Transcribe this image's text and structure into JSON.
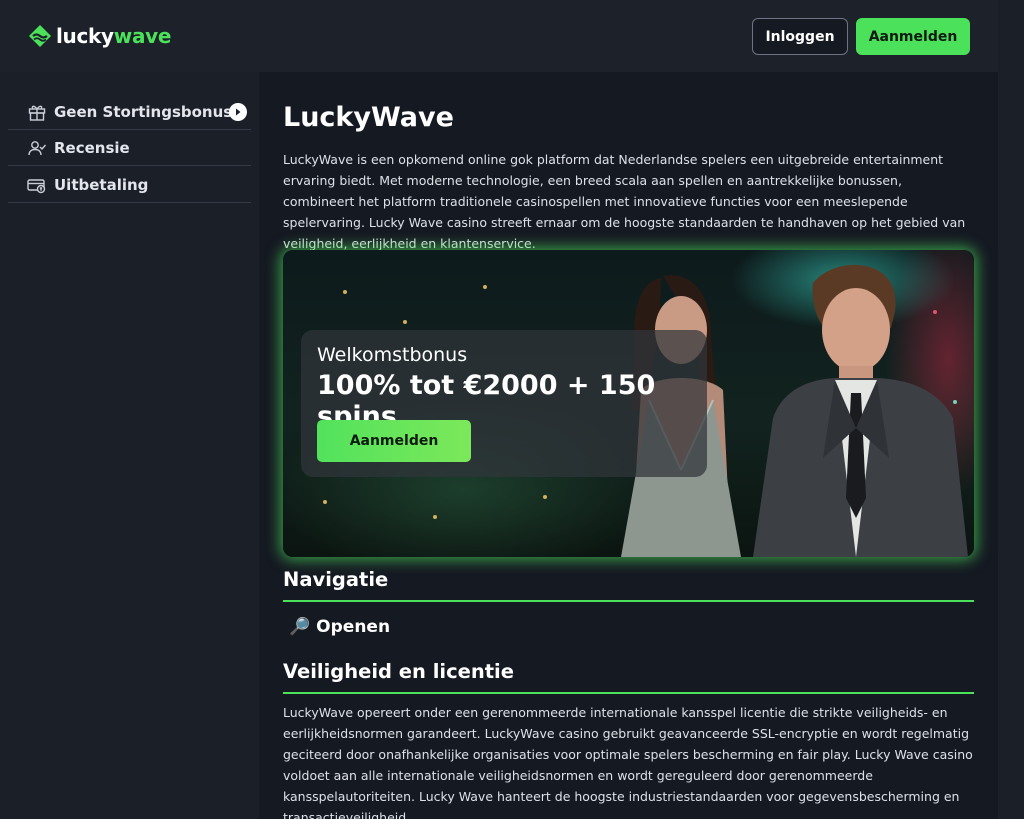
{
  "header": {
    "logo": {
      "part1": "lucky",
      "part2": "wave",
      "icon": "wave-logo-icon"
    },
    "login_label": "Inloggen",
    "signup_label": "Aanmelden"
  },
  "sidebar": {
    "items": [
      {
        "label": "Geen Stortingsbonus",
        "icon": "gift-icon",
        "has_arrow": true
      },
      {
        "label": "Recensie",
        "icon": "user-check-icon"
      },
      {
        "label": "Uitbetaling",
        "icon": "payout-icon"
      }
    ]
  },
  "main": {
    "title": "LuckyWave",
    "intro": "LuckyWave is een opkomend online gok platform dat Nederlandse spelers een uitgebreide entertainment ervaring biedt. Met moderne technologie, een breed scala aan spellen en aantrekkelijke bonussen, combineert het platform traditionele casinospellen met innovatieve functies voor een meeslepende spelervaring. Lucky Wave casino streeft ernaar om de hoogste standaarden te handhaven op het gebied van veiligheid, eerlijkheid en klantenservice.",
    "banner": {
      "subtitle": "Welkomstbonus",
      "headline": "100% tot €2000 + 150 spins",
      "button_label": "Aanmelden"
    },
    "navigation": {
      "heading": "Navigatie",
      "link_icon": "🔎",
      "link_label": "Openen"
    },
    "security": {
      "heading": "Veiligheid en licentie",
      "text": "LuckyWave opereert onder een gerenommeerde internationale kansspel licentie die strikte veiligheids- en eerlijkheidsnormen garandeert. LuckyWave casino gebruikt geavanceerde SSL-encryptie en wordt regelmatig geciteerd door onafhankelijke organisaties voor optimale spelers bescherming en fair play. Lucky Wave casino voldoet aan alle internationale veiligheidsnormen en wordt gereguleerd door gerenommeerde kansspelautoriteiten. Lucky Wave hanteert de hoogste industriestandaarden voor gegevensbescherming en transactieveiligheid."
    }
  },
  "colors": {
    "accent": "#4ce15a",
    "bg": "#151922",
    "sidebar": "#1b1f27"
  }
}
